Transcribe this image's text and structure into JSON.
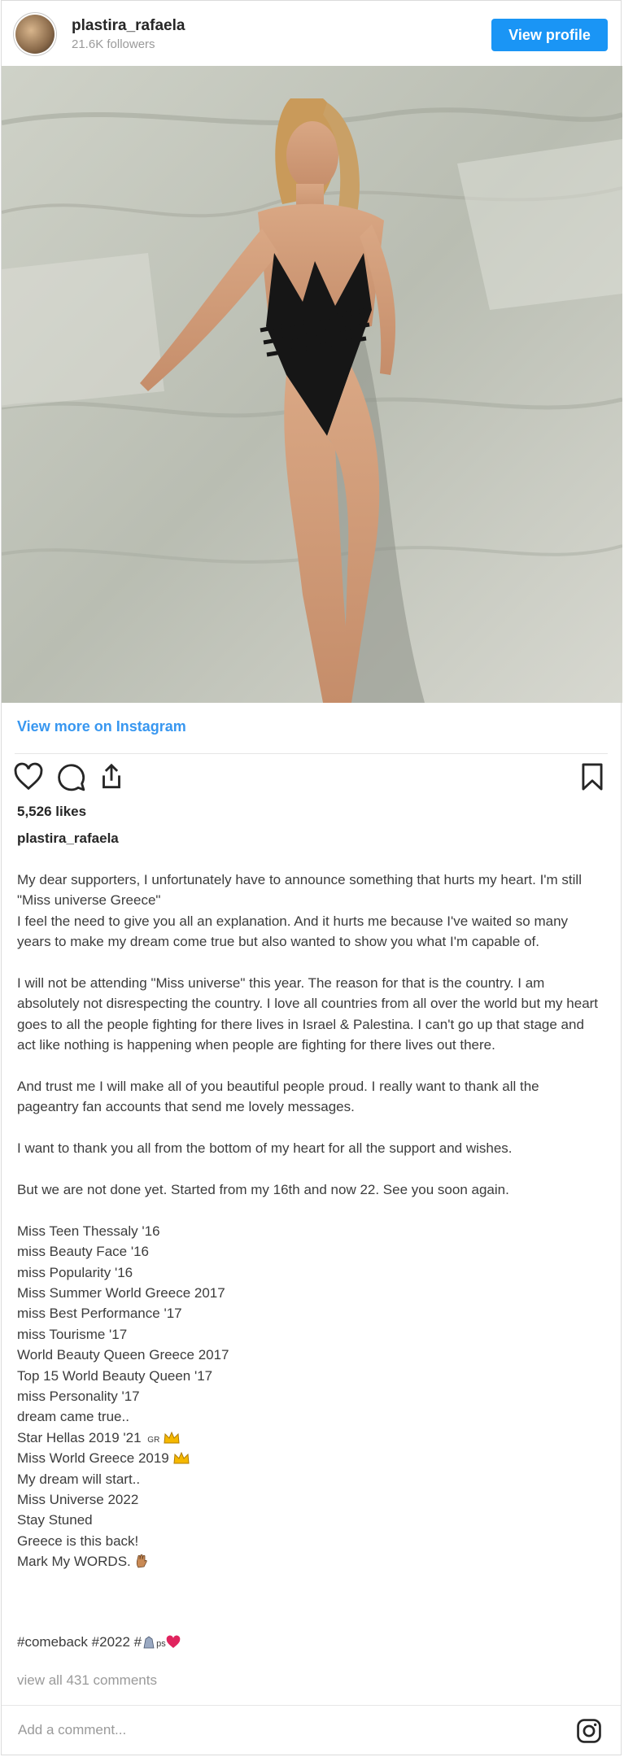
{
  "header": {
    "username": "plastira_rafaela",
    "followers": "21.6K followers",
    "view_profile_label": "View profile"
  },
  "post": {
    "view_more_label": "View more on Instagram",
    "likes": "5,526 likes",
    "author": "plastira_rafaela",
    "paragraphs": [
      "My dear supporters, I unfortunately have to announce something that hurts my heart. I'm still \"Miss universe Greece\"\nI feel the need to give you all an explanation. And it hurts me because I've waited so many years to make my dream come true but also wanted to show you what I'm capable of.",
      "I will not be attending \"Miss universe\" this year. The reason for that is the country. I am absolutely not disrespecting the country. I love all countries from all over the world but my heart goes to all the people fighting for there lives in Israel & Palestina. I can't go up that stage and act like nothing is happening when people are fighting for there lives out there.",
      "And trust me I will make all of you beautiful people proud. I really want to thank all the pageantry fan accounts that send me lovely messages.",
      "I want to thank you all from the bottom of my heart for all the support and wishes.",
      "But we are not done yet. Started from my 16th and now 22. See you soon again."
    ],
    "titles": [
      "Miss Teen Thessaly '16",
      "miss Beauty Face '16",
      "miss Popularity '16",
      "Miss Summer World Greece 2017",
      "miss Best Performance '17",
      "miss Tourisme '17",
      "World Beauty Queen Greece 2017",
      "Top 15 World Beauty Queen '17",
      "miss Personality '17",
      "dream came true..",
      "Star Hellas 2019 '21",
      "Miss World Greece 2019",
      "My dream will start..",
      "Miss Universe 2022",
      "Stay Stuned",
      "Greece is this back!",
      "Mark My WORDS."
    ],
    "star_hellas_flag": "GR",
    "hashtags_prefix": "#comeback #2022 #",
    "hashtags_tail": "ps",
    "view_all_comments": "view all 431 comments",
    "comment_placeholder": "Add a comment..."
  },
  "icons": {
    "like": "heart-icon",
    "comment": "comment-icon",
    "share": "share-icon",
    "save": "bookmark-icon",
    "instagram": "instagram-icon",
    "crown": "crown-emoji",
    "hand": "hand-emoji",
    "heart_red": "red-heart-emoji"
  },
  "colors": {
    "accent": "#1a95f5",
    "link": "#3897f0",
    "heart": "#e0245e"
  }
}
